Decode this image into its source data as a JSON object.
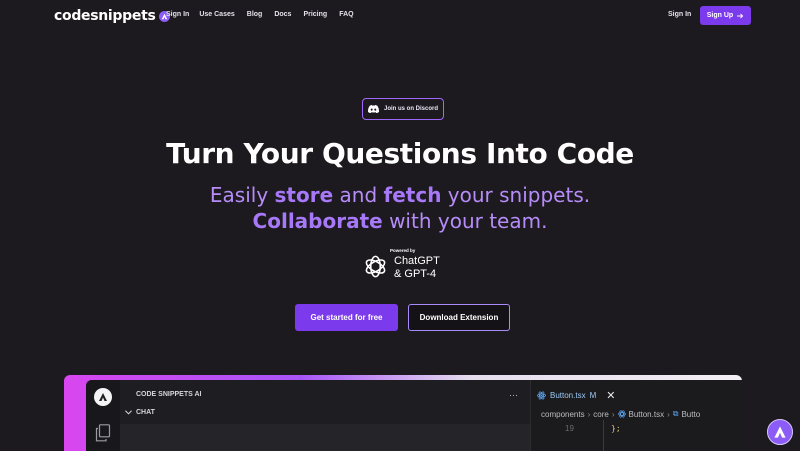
{
  "nav": {
    "logo_text": "codesnippets",
    "links": [
      "Sign In",
      "Use Cases",
      "Blog",
      "Docs",
      "Pricing",
      "FAQ"
    ],
    "sign_in": "Sign In",
    "sign_up": "Sign Up",
    "sign_up_icon": "arrow-right-icon"
  },
  "hero": {
    "discord_label": "Join us on Discord",
    "title": "Turn Your Questions Into Code",
    "subtitle_line1": {
      "pre": "Easily ",
      "b1": "store",
      "mid": " and ",
      "b2": "fetch",
      "post": " your snippets."
    },
    "subtitle_line2": {
      "b1": "Collaborate",
      "post": " with your team."
    },
    "powered_by": "Powered by",
    "powered_name_1": "ChatGPT",
    "powered_name_2": "& GPT-4",
    "cta_primary": "Get started for free",
    "cta_secondary": "Download Extension"
  },
  "editor": {
    "panel_title": "CODE SNIPPETS AI",
    "chat_label": "CHAT",
    "tab_name": "Button.tsx",
    "tab_modified": "M",
    "breadcrumb": [
      "components",
      "core",
      "Button.tsx",
      "Butto"
    ],
    "line_number": "19",
    "code": "};"
  },
  "colors": {
    "accent": "#7c3aed",
    "background": "#1c1a1f",
    "subtitle": "#b68cf9"
  }
}
